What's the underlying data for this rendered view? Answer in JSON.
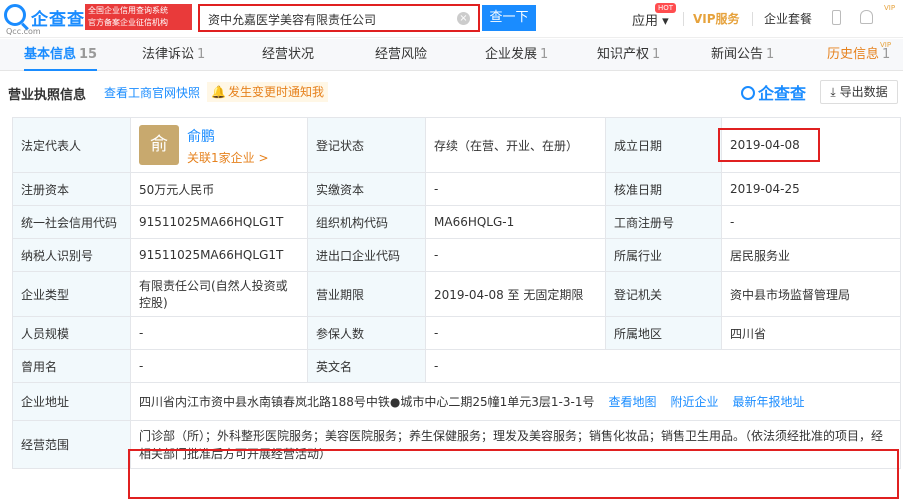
{
  "header": {
    "logo_text": "企查查",
    "logo_sub": "Qcc.com",
    "badge_line1": "全国企业信用查询系统",
    "badge_line2": "官方备案企业征信机构",
    "search_value": "资中允嘉医学美容有限责任公司",
    "search_button": "查一下",
    "nav_apps": "应用",
    "nav_hot": "HOT",
    "nav_vip": "VIP服务",
    "nav_set": "企业套餐",
    "vip_corner": "VIP"
  },
  "tabs": [
    {
      "label": "基本信息",
      "count": "15"
    },
    {
      "label": "法律诉讼",
      "count": "1"
    },
    {
      "label": "经营状况",
      "count": ""
    },
    {
      "label": "经营风险",
      "count": ""
    },
    {
      "label": "企业发展",
      "count": "1"
    },
    {
      "label": "知识产权",
      "count": "1"
    },
    {
      "label": "新闻公告",
      "count": "1"
    },
    {
      "label": "历史信息",
      "count": "1"
    }
  ],
  "section": {
    "title": "营业执照信息",
    "snapshot_link": "查看工商官网快照",
    "notify": "发生变更时通知我",
    "brand": "企查查",
    "export": "导出数据"
  },
  "rows": {
    "legal_rep_label": "法定代表人",
    "legal_rep_avatar": "俞",
    "legal_rep_name": "俞鹏",
    "legal_rep_relation": "关联1家企业 >",
    "reg_status_label": "登记状态",
    "reg_status": "存续（在营、开业、在册）",
    "found_date_label": "成立日期",
    "found_date": "2019-04-08",
    "reg_capital_label": "注册资本",
    "reg_capital": "50万元人民币",
    "paid_capital_label": "实缴资本",
    "paid_capital": "-",
    "approve_date_label": "核准日期",
    "approve_date": "2019-04-25",
    "credit_code_label": "统一社会信用代码",
    "credit_code": "91511025MA66HQLG1T",
    "org_code_label": "组织机构代码",
    "org_code": "MA66HQLG-1",
    "biz_reg_label": "工商注册号",
    "biz_reg": "-",
    "taxpayer_label": "纳税人识别号",
    "taxpayer": "91511025MA66HQLG1T",
    "import_export_label": "进出口企业代码",
    "import_export": "-",
    "industry_label": "所属行业",
    "industry": "居民服务业",
    "company_type_label": "企业类型",
    "company_type": "有限责任公司(自然人投资或控股)",
    "term_label": "营业期限",
    "term": "2019-04-08 至 无固定期限",
    "authority_label": "登记机关",
    "authority": "资中县市场监督管理局",
    "staff_label": "人员规模",
    "staff": "-",
    "insured_label": "参保人数",
    "insured": "-",
    "region_label": "所属地区",
    "region": "四川省",
    "former_name_label": "曾用名",
    "former_name": "-",
    "english_name_label": "英文名",
    "english_name": "-",
    "address_label": "企业地址",
    "address": "四川省内江市资中县水南镇春岚北路188号中铁●城市中心二期25幢1单元3层1-3-1号",
    "address_map": "查看地图",
    "address_nearby": "附近企业",
    "address_report": "最新年报地址",
    "scope_label": "经营范围",
    "scope": "门诊部（所）；外科整形医院服务；美容医院服务；养生保健服务；理发及美容服务；销售化妆品；销售卫生用品。（依法须经批准的项目，经相关部门批准后方可开展经营活动）"
  }
}
